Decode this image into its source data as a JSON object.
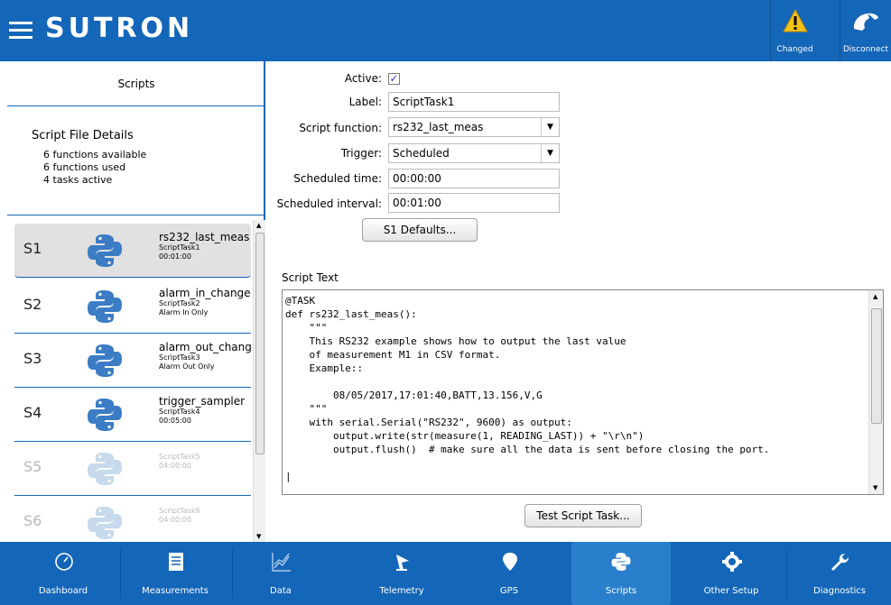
{
  "header": {
    "brand": "SUTRON",
    "changed_label": "Changed",
    "disconnect_label": "Disconnect"
  },
  "left_panel": {
    "title": "Scripts",
    "details_title": "Script File Details",
    "details_lines": [
      "6 functions available",
      "6 functions used",
      "4 tasks active"
    ]
  },
  "tasks": [
    {
      "id": "S1",
      "function": "rs232_last_meas",
      "name": "ScriptTask1",
      "detail": "00:01:00",
      "active": true,
      "selected": true
    },
    {
      "id": "S2",
      "function": "alarm_in_change",
      "name": "ScriptTask2",
      "detail": "Alarm In Only",
      "active": true,
      "selected": false
    },
    {
      "id": "S3",
      "function": "alarm_out_chang",
      "name": "ScriptTask3",
      "detail": "Alarm Out Only",
      "active": true,
      "selected": false
    },
    {
      "id": "S4",
      "function": "trigger_sampler",
      "name": "ScriptTask4",
      "detail": "00:05:00",
      "active": true,
      "selected": false
    },
    {
      "id": "S5",
      "function": "",
      "name": "ScriptTask5",
      "detail": "04:00:00",
      "active": false,
      "selected": false
    },
    {
      "id": "S6",
      "function": "",
      "name": "ScriptTask6",
      "detail": "04:00:00",
      "active": false,
      "selected": false
    }
  ],
  "form": {
    "active_label": "Active:",
    "active_checked": "✓",
    "label_label": "Label:",
    "label_value": "ScriptTask1",
    "function_label": "Script function:",
    "function_value": "rs232_last_meas",
    "trigger_label": "Trigger:",
    "trigger_value": "Scheduled",
    "time_label": "Scheduled time:",
    "time_value": "00:00:00",
    "interval_label": "Scheduled interval:",
    "interval_value": "00:01:00",
    "defaults_button": "S1 Defaults..."
  },
  "script": {
    "label": "Script Text",
    "code": "@TASK\ndef rs232_last_meas():\n    \"\"\"\n    This RS232 example shows how to output the last value\n    of measurement M1 in CSV format.\n    Example::\n\n        08/05/2017,17:01:40,BATT,13.156,V,G\n    \"\"\"\n    with serial.Serial(\"RS232\", 9600) as output:\n        output.write(str(measure(1, READING_LAST)) + \"\\r\\n\")\n        output.flush()  # make sure all the data is sent before closing the port.\n\n|",
    "test_button": "Test Script Task..."
  },
  "nav": {
    "items": [
      {
        "label": "Dashboard",
        "icon": "gauge-icon"
      },
      {
        "label": "Measurements",
        "icon": "document-icon"
      },
      {
        "label": "Data",
        "icon": "chart-icon"
      },
      {
        "label": "Telemetry",
        "icon": "antenna-icon"
      },
      {
        "label": "GPS",
        "icon": "location-pin-icon"
      },
      {
        "label": "Scripts",
        "icon": "python-icon"
      },
      {
        "label": "Other Setup",
        "icon": "gear-icon"
      },
      {
        "label": "Diagnostics",
        "icon": "wrench-icon"
      }
    ],
    "active": "Scripts"
  },
  "colors": {
    "primary": "#1466b8",
    "python_blue": "#3b7cc4",
    "inactive": "#c7d9ec"
  }
}
